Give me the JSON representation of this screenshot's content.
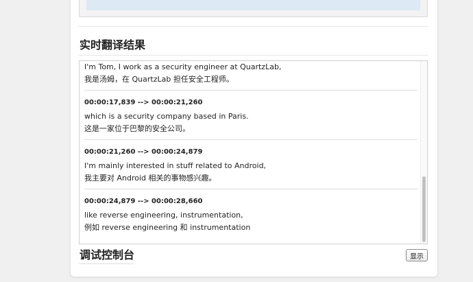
{
  "sections": {
    "realtime_title": "实时翻译结果",
    "debug_title": "调试控制台"
  },
  "debug": {
    "show_button_label": "显示"
  },
  "results": {
    "partial_top": "…",
    "entries": [
      {
        "timestamp": "",
        "en": "I'm Tom, I work as a security engineer at QuartzLab,",
        "zh": "我是汤姆，在 QuartzLab 担任安全工程师。"
      },
      {
        "timestamp": "00:00:17,839 --> 00:00:21,260",
        "en": "which is a security company based in Paris.",
        "zh": "这是一家位于巴黎的安全公司。"
      },
      {
        "timestamp": "00:00:21,260 --> 00:00:24,879",
        "en": "I'm mainly interested in stuff related to Android,",
        "zh": "我主要对 Android 相关的事物感兴趣。"
      },
      {
        "timestamp": "00:00:24,879 --> 00:00:28,660",
        "en": "like reverse engineering, instrumentation,",
        "zh": "例如 reverse engineering 和 instrumentation"
      }
    ]
  }
}
